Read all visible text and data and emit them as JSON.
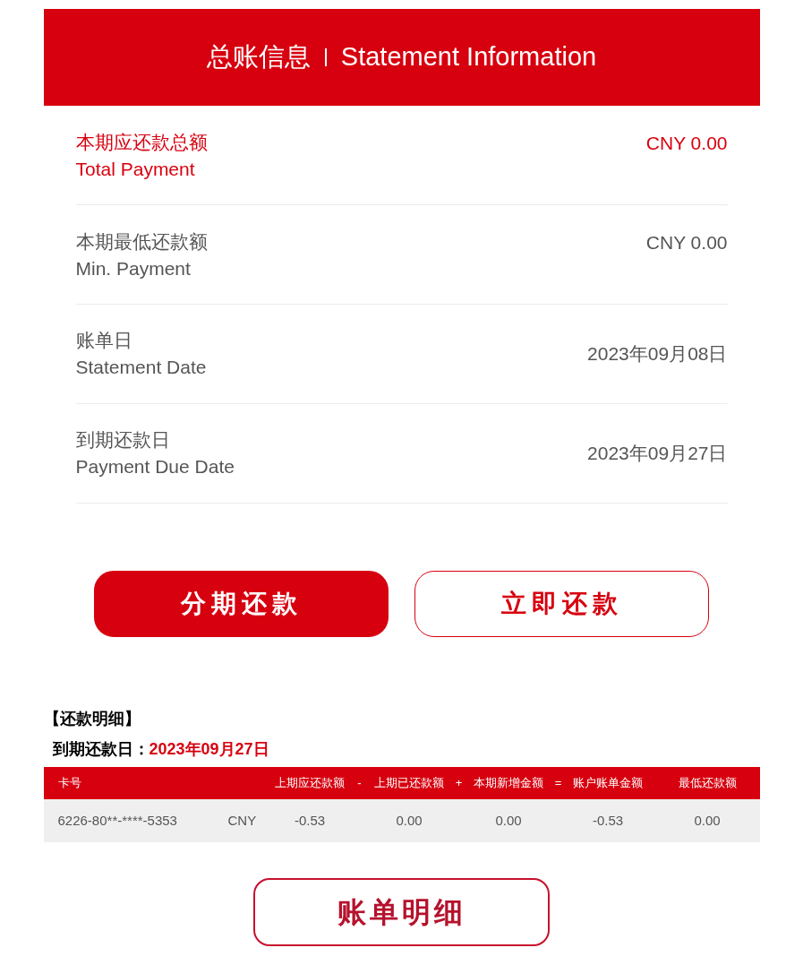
{
  "header": {
    "title_cn": "总账信息",
    "title_en": "Statement Information"
  },
  "summary": [
    {
      "label_cn": "本期应还款总额",
      "label_en": "Total Payment",
      "value": "CNY 0.00",
      "emphasized": true
    },
    {
      "label_cn": "本期最低还款额",
      "label_en": "Min. Payment",
      "value": "CNY 0.00",
      "emphasized": false
    },
    {
      "label_cn": "账单日",
      "label_en": "Statement Date",
      "value": "2023年09月08日",
      "emphasized": false
    },
    {
      "label_cn": "到期还款日",
      "label_en": "Payment Due Date",
      "value": "2023年09月27日",
      "emphasized": false
    }
  ],
  "actions": [
    {
      "label": "分期还款",
      "kind": "primary"
    },
    {
      "label": "立即还款",
      "kind": "outline"
    }
  ],
  "details": {
    "heading": "【还款明细】",
    "due_label": "到期还款日：",
    "due_value": "2023年09月27日",
    "columns": [
      {
        "label": "卡号"
      },
      {},
      {
        "label": "上期应还款额",
        "operator": "-"
      },
      {
        "label": "上期已还款额",
        "operator": "+"
      },
      {
        "label": "本期新增金额",
        "operator": "="
      },
      {
        "label": "账户账单金额"
      },
      {
        "label": "最低还款额"
      }
    ],
    "rows": [
      [
        "6226-80**-****-5353",
        "CNY",
        "-0.53",
        "0.00",
        "0.00",
        "-0.53",
        "0.00"
      ]
    ]
  },
  "footer_button": {
    "label": "账单明细"
  }
}
